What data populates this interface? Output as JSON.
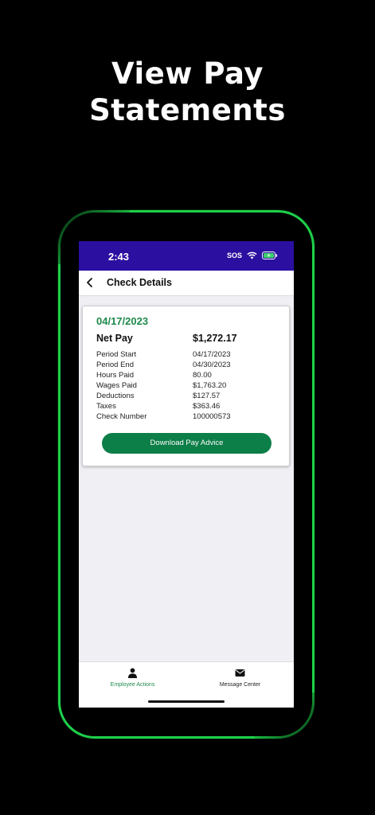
{
  "headline": {
    "line1": "View Pay",
    "line2": "Statements"
  },
  "status_bar": {
    "time": "2:43",
    "sos": "SOS",
    "background": "#2b0fa0"
  },
  "nav": {
    "title": "Check Details",
    "back_icon": "chevron-left-icon"
  },
  "check": {
    "date": "04/17/2023",
    "net_pay_label": "Net Pay",
    "net_pay_value": "$1,272.17",
    "details": [
      {
        "label": "Period Start",
        "value": "04/17/2023"
      },
      {
        "label": "Period End",
        "value": "04/30/2023"
      },
      {
        "label": "Hours Paid",
        "value": "80.00"
      },
      {
        "label": "Wages Paid",
        "value": "$1,763.20"
      },
      {
        "label": "Deductions",
        "value": "$127.57"
      },
      {
        "label": "Taxes",
        "value": "$363.46"
      },
      {
        "label": "Check Number",
        "value": "100000573"
      }
    ],
    "download_button": "Download Pay Advice"
  },
  "tab_bar": {
    "tabs": [
      {
        "label": "Employee Actions",
        "icon": "person-icon",
        "active": true
      },
      {
        "label": "Message Center",
        "icon": "envelope-icon",
        "active": false
      }
    ]
  },
  "colors": {
    "accent_green": "#1e8a4c",
    "button_green": "#0c7e47",
    "frame_green": "#1ed04a"
  }
}
